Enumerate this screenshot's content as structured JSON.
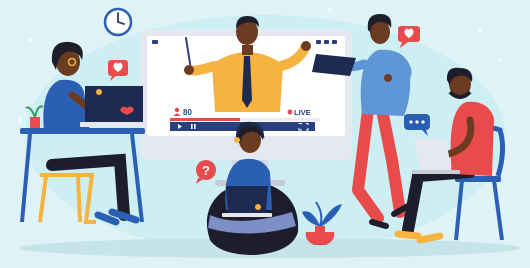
{
  "video_player": {
    "viewer_count": "80",
    "live_label": "LIVE"
  },
  "icons": {
    "clock": "clock-icon",
    "heart_badges": "heart-icon",
    "chat_badge": "chat-bubble-icon",
    "question_badge": "question-icon",
    "play": "play-icon",
    "pause": "pause-icon",
    "fullscreen": "fullscreen-icon",
    "user": "user-icon"
  },
  "colors": {
    "background": "#dff3f6",
    "monitor_frame": "#e6e8ef",
    "screen": "#ffffff",
    "presenter_shirt": "#f6b33f",
    "accent_red": "#e84b4b",
    "navy": "#2b3f7f"
  }
}
